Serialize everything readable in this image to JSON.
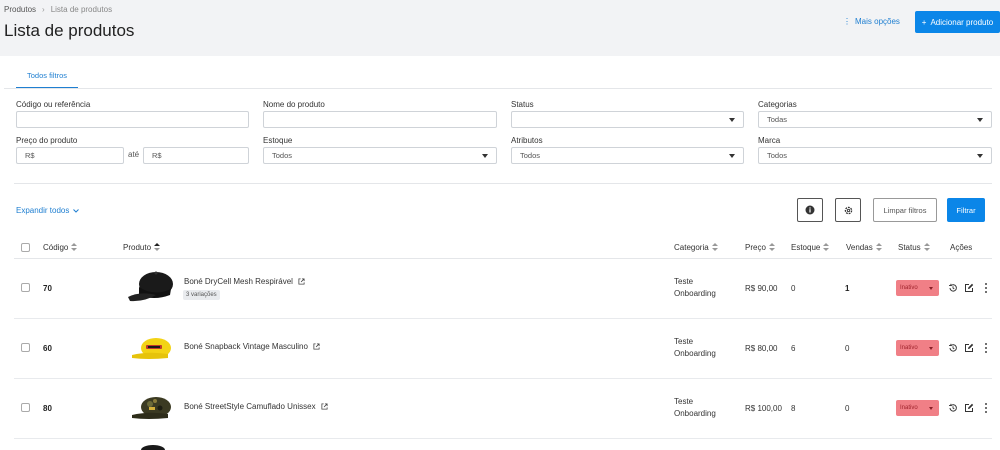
{
  "breadcrumb": {
    "root": "Produtos",
    "current": "Lista de produtos"
  },
  "page_title": "Lista de produtos",
  "header_actions": {
    "more_options": "Mais opções",
    "add_product": "Adicionar produto"
  },
  "tabs": {
    "all_filters": "Todos filtros"
  },
  "filters": {
    "code_label": "Código ou referência",
    "name_label": "Nome do produto",
    "status_label": "Status",
    "categories_label": "Categorias",
    "categories_value": "Todas",
    "price_label": "Preço do produto",
    "price_from_placeholder": "R$",
    "price_between": "até",
    "price_to_placeholder": "R$",
    "stock_label": "Estoque",
    "stock_value": "Todos",
    "attributes_label": "Atributos",
    "attributes_value": "Todos",
    "brand_label": "Marca",
    "brand_value": "Todos"
  },
  "toolbar": {
    "expand_all": "Expandir todos",
    "clear_filters": "Limpar filtros",
    "filter": "Filtrar"
  },
  "table": {
    "headers": {
      "code": "Código",
      "product": "Produto",
      "category": "Categoria",
      "price": "Preço",
      "stock": "Estoque",
      "sales": "Vendas",
      "status": "Status",
      "actions": "Ações"
    },
    "rows": [
      {
        "code": "70",
        "name": "Boné DryCell Mesh Respirável",
        "badge": "3 variações",
        "category_line1": "Teste",
        "category_line2": "Onboarding",
        "price": "R$ 90,00",
        "stock": "0",
        "sales": "1",
        "status": "Inativo"
      },
      {
        "code": "60",
        "name": "Boné Snapback Vintage Masculino",
        "category_line1": "Teste",
        "category_line2": "Onboarding",
        "price": "R$ 80,00",
        "stock": "6",
        "sales": "0",
        "status": "Inativo"
      },
      {
        "code": "80",
        "name": "Boné StreetStyle Camuflado Unissex",
        "category_line1": "Teste",
        "category_line2": "Onboarding",
        "price": "R$ 100,00",
        "stock": "8",
        "sales": "0",
        "status": "Inativo"
      }
    ]
  },
  "colors": {
    "primary": "#0b86e8",
    "link": "#1f7fd1",
    "status_inactive": "#f07f86"
  },
  "icons": [
    "chevron-right-icon",
    "kebab-icon",
    "plus-icon",
    "chevron-down-icon",
    "info-icon",
    "settings-icon",
    "external-link-icon",
    "history-icon",
    "edit-icon",
    "more-vertical-icon"
  ]
}
